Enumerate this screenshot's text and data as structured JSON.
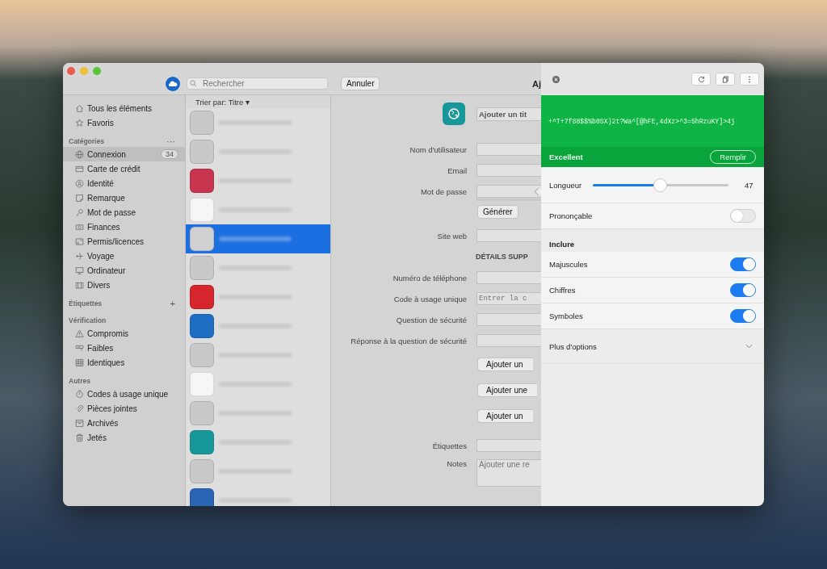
{
  "toolbar": {
    "search_placeholder": "Rechercher",
    "cancel_button": "Annuler",
    "form_title": "Aj"
  },
  "sidebar": {
    "sections": [
      {
        "items": [
          {
            "label": "Tous les éléments",
            "selected": false
          },
          {
            "label": "Favoris",
            "selected": false
          }
        ]
      },
      {
        "title": "Catégories",
        "action": "···",
        "items": [
          {
            "label": "Connexion",
            "selected": true,
            "badge": "34"
          },
          {
            "label": "Carte de crédit",
            "selected": false
          },
          {
            "label": "Identité",
            "selected": false
          },
          {
            "label": "Remarque",
            "selected": false
          },
          {
            "label": "Mot de passe",
            "selected": false
          },
          {
            "label": "Finances",
            "selected": false
          },
          {
            "label": "Permis/licences",
            "selected": false
          },
          {
            "label": "Voyage",
            "selected": false
          },
          {
            "label": "Ordinateur",
            "selected": false
          },
          {
            "label": "Divers",
            "selected": false
          }
        ]
      },
      {
        "title": "Étiquettes",
        "action": "+"
      },
      {
        "title": "Vérification",
        "items": [
          {
            "label": "Compromis",
            "selected": false
          },
          {
            "label": "Faibles",
            "selected": false
          },
          {
            "label": "Identiques",
            "selected": false
          }
        ]
      },
      {
        "title": "Autres",
        "items": [
          {
            "label": "Codes à usage unique",
            "selected": false
          },
          {
            "label": "Pièces jointes",
            "selected": false
          },
          {
            "label": "Archivés",
            "selected": false
          },
          {
            "label": "Jetés",
            "selected": false
          }
        ]
      }
    ]
  },
  "list": {
    "sort_label": "Trier par:",
    "sort_value": "Titre",
    "sort_caret": "▾",
    "items": [
      {
        "color": "#c9c9c9",
        "selected": false
      },
      {
        "color": "#c9c9c9",
        "selected": false
      },
      {
        "color": "#c8354e",
        "selected": false
      },
      {
        "color": "#f6f6f6",
        "selected": false
      },
      {
        "color": "#d0d0d0",
        "selected": true
      },
      {
        "color": "#c9c9c9",
        "selected": false
      },
      {
        "color": "#d6252c",
        "selected": false
      },
      {
        "color": "#1e6fc4",
        "selected": false
      },
      {
        "color": "#c9c9c9",
        "selected": false
      },
      {
        "color": "#f6f6f6",
        "selected": false
      },
      {
        "color": "#c9c9c9",
        "selected": false
      },
      {
        "color": "#17979a",
        "selected": false
      },
      {
        "color": "#c9c9c9",
        "selected": false
      },
      {
        "color": "#2a64b5",
        "selected": false
      }
    ]
  },
  "form": {
    "title_placeholder": "Ajouter un tit",
    "fields": [
      {
        "label": "Nom d'utilisateur"
      },
      {
        "label": "Email"
      },
      {
        "label": "Mot de passe",
        "kind": "password"
      }
    ],
    "generate_button": "Générer",
    "website": {
      "label": "Site web"
    },
    "section_title": "DÉTAILS SUPP",
    "details": [
      {
        "label": "Numéro de téléphone"
      },
      {
        "label": "Code à usage unique",
        "placeholder": "Entrer la c"
      },
      {
        "label": "Question de sécurité"
      },
      {
        "label": "Réponse à la question de sécurité"
      }
    ],
    "add_buttons": [
      "Ajouter un",
      "Ajouter une",
      "Ajouter un"
    ],
    "tags": {
      "label": "Étiquettes"
    },
    "notes": {
      "label": "Notes",
      "placeholder": "Ajouter une re"
    }
  },
  "generator": {
    "password": "+^T+7f88$$%b0SX)2t?Wa^[@hFE,4dXz>^3=5hRzuKY]>4j",
    "strength": "Excellent",
    "fill_button": "Remplir",
    "length": {
      "label": "Longueur",
      "level": 0.45,
      "value": "47"
    },
    "pronounceable": {
      "label": "Prononçable",
      "on": false
    },
    "include_title": "Inclure",
    "options": [
      {
        "label": "Majuscules",
        "on": true
      },
      {
        "label": "Chiffres",
        "on": true
      },
      {
        "label": "Symboles",
        "on": true
      }
    ],
    "more": "Plus d'options"
  }
}
